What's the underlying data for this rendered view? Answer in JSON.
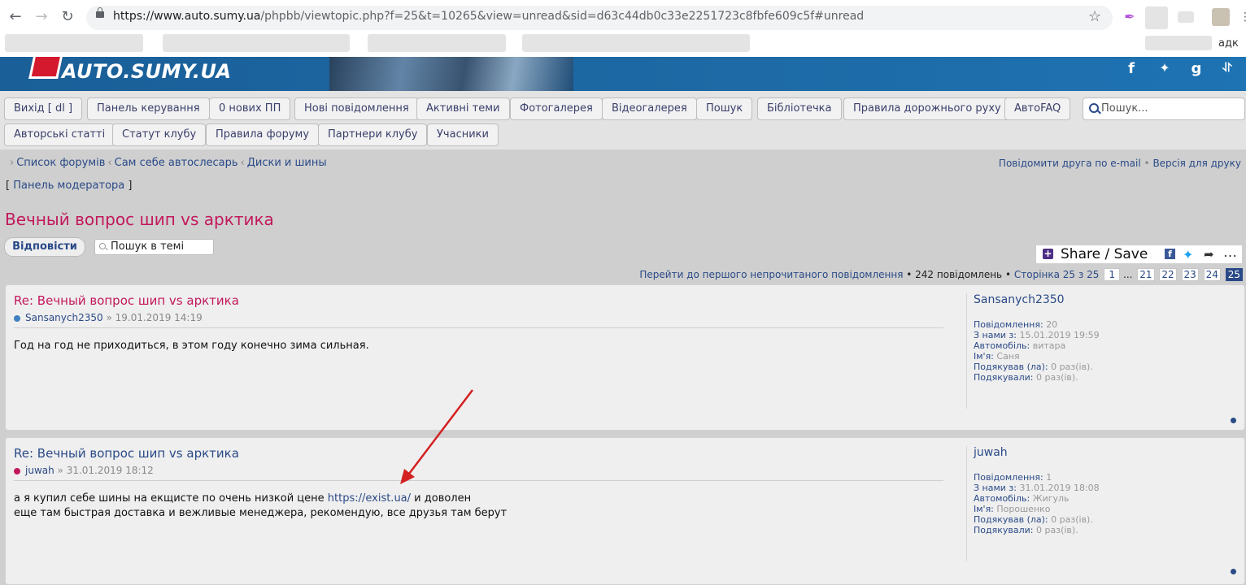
{
  "browser": {
    "url_host": "https://www.auto.sumy.ua",
    "url_rest": "/phpbb/viewtopic.php?f=25&t=10265&view=unread&sid=d63c44db0c33e2251723c8fbfe609c5f#unread",
    "partial_label": "адк"
  },
  "site": {
    "logo": "AUTO.SUMY.UA",
    "social": [
      "f",
      "t",
      "g",
      "rss"
    ]
  },
  "nav": {
    "row1": [
      "Вихід [ dl ]",
      "Панель керування",
      "0 нових ПП",
      "Нові повідомлення",
      "Активні теми",
      "Фотогалерея",
      "Відеогалерея",
      "Пошук",
      "Бібліотечка",
      "Правила дорожнього руху",
      "АвтоFAQ"
    ],
    "row2": [
      "Авторські статті",
      "Статут клубу",
      "Правила форуму",
      "Партнери клубу",
      "Учасники"
    ],
    "search_placeholder": "Пошук..."
  },
  "breadcrumb": [
    "Список форумів",
    "Сам себе автослесарь",
    "Диски и шины"
  ],
  "toplinks": {
    "email": "Повідомити друга по e-mail",
    "print": "Версія для друку"
  },
  "mod_panel": {
    "open": "[",
    "label": "Панель модератора",
    "close": "]"
  },
  "topic": {
    "title": "Вечный вопрос шип vs арктика",
    "reply": "Відповісти",
    "search": "Пошук в темі",
    "share": "Share / Save"
  },
  "pagination": {
    "first_unread": "Перейти до першого непрочитаного повідомлення",
    "count": "242 повідомлень",
    "page": "Сторінка 25 з 25",
    "pages": [
      "1",
      "...",
      "21",
      "22",
      "23",
      "24",
      "25"
    ],
    "current": "25"
  },
  "posts": [
    {
      "title": "Re: Вечный вопрос шип vs арктика",
      "author": "Sansanych2350",
      "date": "» 19.01.2019 14:19",
      "lines": [
        "Год на год не приходиться, в этом году конечно зима сильная."
      ],
      "profile": {
        "name": "Sansanych2350",
        "posts_label": "Повідомлення:",
        "posts": "20",
        "joined_label": "З нами з:",
        "joined": "15.01.2019 19:59",
        "car_label": "Автомобіль:",
        "car": "витара",
        "name_label": "Ім'я:",
        "real_name": "Саня",
        "thanked_label": "Подякував (ла):",
        "thanked": "0 раз(ів).",
        "thanks_label": "Подякували:",
        "thanks": "0 раз(ів)."
      },
      "title_color": "#c2185b",
      "bullet_color": "#3f7fc2"
    },
    {
      "title": "Re: Вечный вопрос шип vs арктика",
      "author": "juwah",
      "date": "» 31.01.2019 18:12",
      "line1_a": "а я купил себе шины на екщисте по очень низкой цене",
      "line1_link": "https://exist.ua/",
      "line1_b": "и доволен",
      "line2": "еще там быстрая доставка и вежливые менеджера, рекомендую, все друзья там берут",
      "profile": {
        "name": "juwah",
        "posts_label": "Повідомлення:",
        "posts": "1",
        "joined_label": "З нами з:",
        "joined": "31.01.2019 18:08",
        "car_label": "Автомобіль:",
        "car": "Жигуль",
        "name_label": "Ім'я:",
        "real_name": "Порошенко",
        "thanked_label": "Подякував (ла):",
        "thanked": "0 раз(ів).",
        "thanks_label": "Подякували:",
        "thanks": "0 раз(ів)."
      },
      "title_color": "#2a4a87",
      "bullet_color": "#c2185b"
    }
  ],
  "colors": {
    "accent": "#2a4a87",
    "title": "#c2185b",
    "banner": "#1d6aa6",
    "annotation": "#d32020"
  }
}
